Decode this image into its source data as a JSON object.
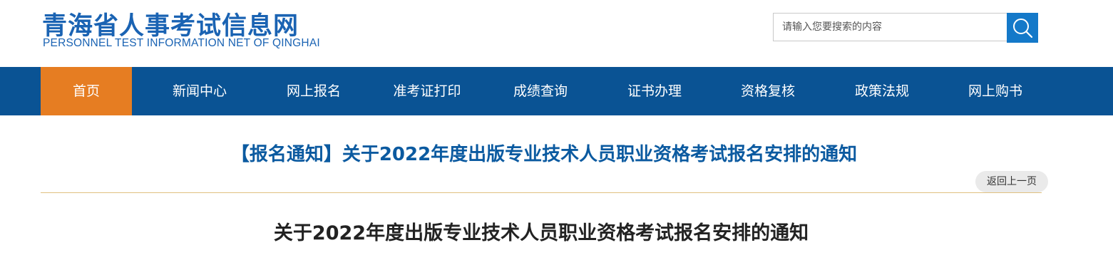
{
  "header": {
    "logo_cn": "青海省人事考试信息网",
    "logo_en": "PERSONNEL TEST INFORMATION NET OF QINGHAI",
    "search_placeholder": "请输入您要搜索的内容",
    "search_icon": "search-icon"
  },
  "nav": {
    "items": [
      {
        "label": "首页",
        "active": true
      },
      {
        "label": "新闻中心"
      },
      {
        "label": "网上报名"
      },
      {
        "label": "准考证打印"
      },
      {
        "label": "成绩查询"
      },
      {
        "label": "证书办理"
      },
      {
        "label": "资格复核"
      },
      {
        "label": "政策法规"
      },
      {
        "label": "网上购书"
      }
    ]
  },
  "page": {
    "title": "【报名通知】关于2022年度出版专业技术人员职业资格考试报名安排的通知",
    "back_label": "返回上一页",
    "article_title": "关于2022年度出版专业技术人员职业资格考试报名安排的通知"
  },
  "colors": {
    "brand_blue": "#1a63b3",
    "nav_bg": "#0a5394",
    "active_orange": "#e67d22",
    "search_button": "#1479c9",
    "title_blue": "#0b5aa0"
  }
}
